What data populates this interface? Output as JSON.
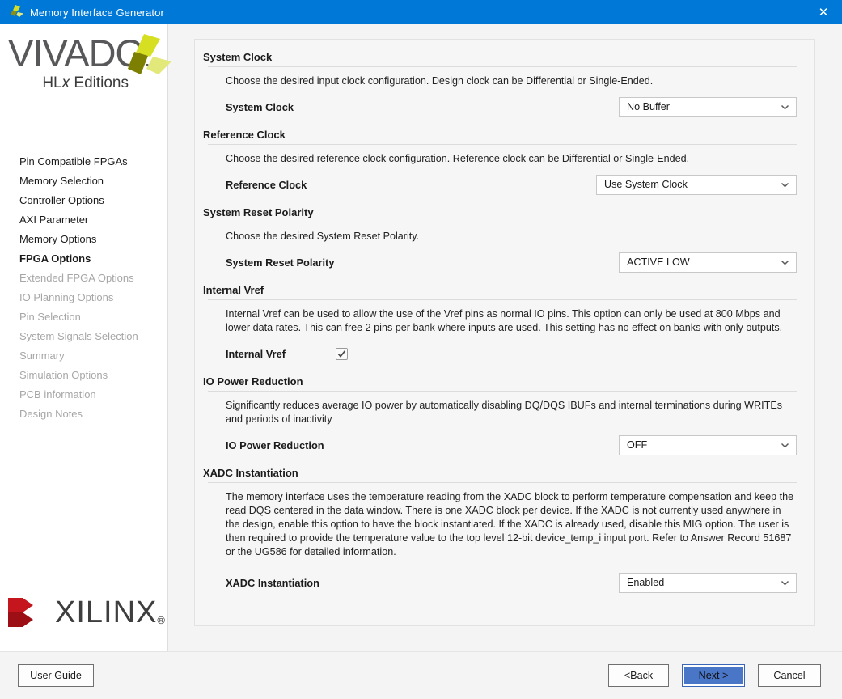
{
  "window": {
    "title": "Memory Interface Generator",
    "icon": "vivado-pinwheel-icon",
    "close_label": "✕",
    "accent_color": "#0078d7"
  },
  "branding": {
    "vivado_word": "VIVADO",
    "vivado_dot": ".",
    "vivado_sub_pre": "HL",
    "vivado_sub_italic": "x",
    "vivado_sub_post": " Editions",
    "xilinx_word": "XILINX",
    "xilinx_reg": "®",
    "xilinx_red": "#c4161c",
    "logo_green_light": "#d7df23",
    "logo_green_dark": "#7d7f00",
    "logo_green_pale": "#e3e87a"
  },
  "sidebar": {
    "items": [
      {
        "label": "Pin Compatible FPGAs",
        "state": "normal"
      },
      {
        "label": "Memory Selection",
        "state": "normal"
      },
      {
        "label": "Controller Options",
        "state": "normal"
      },
      {
        "label": "AXI Parameter",
        "state": "normal"
      },
      {
        "label": "Memory Options",
        "state": "normal"
      },
      {
        "label": "FPGA Options",
        "state": "active"
      },
      {
        "label": "Extended FPGA Options",
        "state": "disabled"
      },
      {
        "label": "IO Planning Options",
        "state": "disabled"
      },
      {
        "label": "Pin Selection",
        "state": "disabled"
      },
      {
        "label": "System Signals Selection",
        "state": "disabled"
      },
      {
        "label": "Summary",
        "state": "disabled"
      },
      {
        "label": "Simulation Options",
        "state": "disabled"
      },
      {
        "label": "PCB information",
        "state": "disabled"
      },
      {
        "label": "Design Notes",
        "state": "disabled"
      }
    ]
  },
  "sections": {
    "system_clock": {
      "title": "System Clock",
      "description": "Choose the desired input clock configuration. Design clock can be Differential or Single-Ended.",
      "field_label": "System Clock",
      "value": "No Buffer"
    },
    "reference_clock": {
      "title": "Reference Clock",
      "description": "Choose the desired reference clock configuration. Reference clock can be Differential or Single-Ended.",
      "field_label": "Reference Clock",
      "value": "Use System Clock"
    },
    "system_reset_polarity": {
      "title": "System Reset Polarity",
      "description": "Choose the desired System Reset Polarity.",
      "field_label": "System Reset Polarity",
      "value": "ACTIVE LOW"
    },
    "internal_vref": {
      "title": "Internal Vref",
      "description": "Internal Vref can be used to allow the use of the Vref pins as normal IO pins. This option can only be used at 800 Mbps and lower data rates. This can free 2 pins per bank where inputs are used. This setting has no effect on banks with only outputs.",
      "field_label": "Internal Vref",
      "checked": true
    },
    "io_power_reduction": {
      "title": "IO Power Reduction",
      "description": "Significantly reduces average IO power by automatically disabling DQ/DQS IBUFs and internal terminations during WRITEs and periods of inactivity",
      "field_label": "IO Power Reduction",
      "value": "OFF"
    },
    "xadc_instantiation": {
      "title": "XADC Instantiation",
      "description": "The memory interface uses the temperature reading from the XADC block to perform temperature compensation and keep the read DQS centered in the data window. There is one XADC block per device. If the XADC is not currently used anywhere in the design, enable this option to have the block instantiated. If the XADC is already used, disable this MIG option. The user is then required to provide the temperature value to the top level 12-bit device_temp_i input port. Refer to Answer Record 51687 or the UG586 for detailed information.",
      "field_label": "XADC Instantiation",
      "value": "Enabled"
    }
  },
  "footer": {
    "user_guide": {
      "pre": "",
      "accel": "U",
      "post": "ser Guide"
    },
    "back": {
      "pre": "< ",
      "accel": "B",
      "post": "ack"
    },
    "next": {
      "pre": "",
      "accel": "N",
      "post": "ext >"
    },
    "cancel": "Cancel",
    "next_button_color": "#4a76c8"
  }
}
